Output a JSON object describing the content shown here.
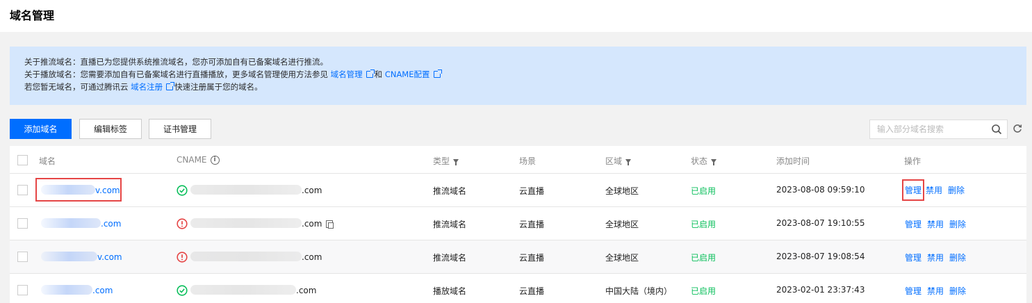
{
  "page": {
    "title": "域名管理"
  },
  "info": {
    "line1": "关于推流域名：直播已为您提供系统推流域名，您亦可添加自有已备案域名进行推流。",
    "line2_prefix": "关于播放域名：您需要添加自有已备案域名进行直播播放，更多域名管理使用方法参见",
    "line2_link1": "域名管理",
    "line2_mid": "和",
    "line2_link2": "CNAME配置",
    "line3_prefix": "若您暂无域名，可通过腾讯云",
    "line3_link": "域名注册",
    "line3_suffix": "快速注册属于您的域名。"
  },
  "toolbar": {
    "add_label": "添加域名",
    "edit_tags_label": "编辑标签",
    "cert_label": "证书管理",
    "search_placeholder": "输入部分域名搜索"
  },
  "table": {
    "headers": {
      "domain": "域名",
      "cname": "CNAME",
      "type": "类型",
      "scene": "场景",
      "region": "区域",
      "status": "状态",
      "added": "添加时间",
      "actions": "操作"
    },
    "rows": [
      {
        "domain_suffix": "v.com",
        "cname_state": "ok",
        "cname_suffix": ".com",
        "type": "推流域名",
        "scene": "云直播",
        "region": "全球地区",
        "status": "已启用",
        "added": "2023-08-08 09:59:10",
        "manage": "管理",
        "disable": "禁用",
        "delete": "删除"
      },
      {
        "domain_suffix": ".com",
        "cname_state": "warn",
        "cname_suffix": ".com",
        "type": "推流域名",
        "scene": "云直播",
        "region": "全球地区",
        "status": "已启用",
        "added": "2023-08-07 19:10:55",
        "manage": "管理",
        "disable": "禁用",
        "delete": "删除"
      },
      {
        "domain_suffix": "v.com",
        "cname_state": "warn",
        "cname_suffix": ".com",
        "type": "推流域名",
        "scene": "云直播",
        "region": "全球地区",
        "status": "已启用",
        "added": "2023-08-07 19:08:54",
        "manage": "管理",
        "disable": "禁用",
        "delete": "删除"
      },
      {
        "domain_suffix": ".com",
        "cname_state": "ok",
        "cname_suffix": ".com",
        "type": "播放域名",
        "scene": "云直播",
        "region": "中国大陆（境内）",
        "status": "已启用",
        "added": "2023-02-01 23:37:43",
        "manage": "管理",
        "disable": "禁用",
        "delete": "删除"
      }
    ]
  },
  "colors": {
    "primary": "#006eff",
    "success": "#0abf5b",
    "danger": "#e54545",
    "info_bg": "#d5e7fd"
  }
}
